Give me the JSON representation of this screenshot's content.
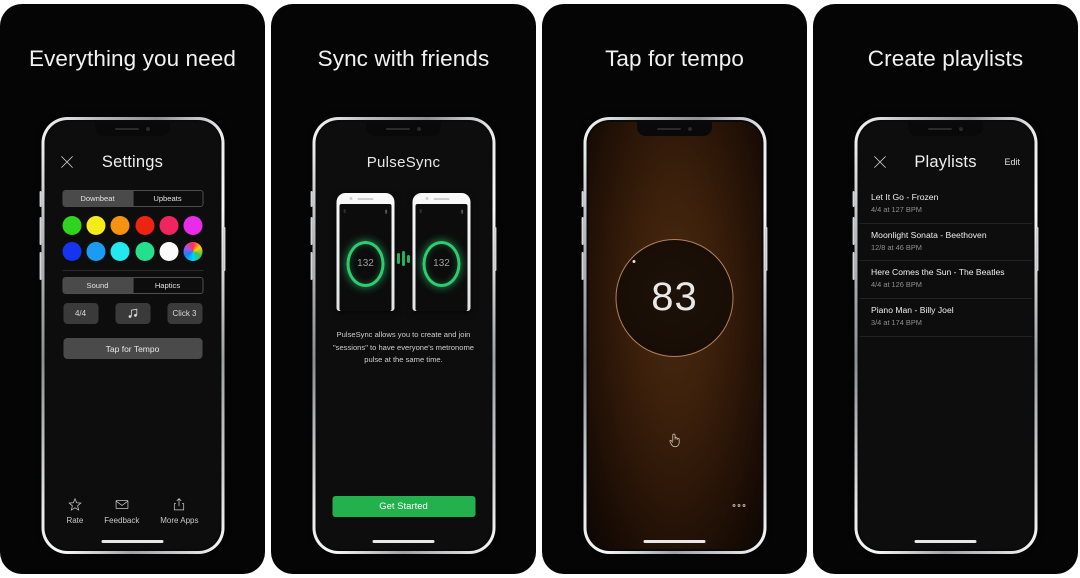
{
  "panels": [
    {
      "title": "Everything you need",
      "screen": {
        "close_icon": "close-icon",
        "title": "Settings",
        "beat_segment": {
          "options": [
            "Downbeat",
            "Upbeats"
          ],
          "selected": "Downbeat"
        },
        "colors": [
          "#2fd41f",
          "#f4eb1a",
          "#f59211",
          "#ee2413",
          "#f0245e",
          "#e92ce9",
          "#1633f0",
          "#1b9cf4",
          "#23e8f0",
          "#24e08d",
          "#fbfbfb",
          "rainbow"
        ],
        "output_segment": {
          "options": [
            "Sound",
            "Haptics"
          ],
          "selected": "Sound"
        },
        "controls": {
          "time_signature": "4/4",
          "sound_icon": "music-note-icon",
          "click": "Click 3"
        },
        "tap_button": "Tap for Tempo",
        "tabs": [
          {
            "label": "Rate",
            "icon": "star-icon"
          },
          {
            "label": "Feedback",
            "icon": "envelope-icon"
          },
          {
            "label": "More Apps",
            "icon": "share-icon"
          }
        ]
      }
    },
    {
      "title": "Sync with friends",
      "screen": {
        "app_name": "PulseSync",
        "device_bpm_left": "132",
        "device_bpm_right": "132",
        "sync_icon": "wireless-waves-icon",
        "body": "PulseSync allows you to create and join \"sessions\" to have everyone's metronome pulse at the same time.",
        "cta": "Get Started",
        "cta_color": "#22b14c"
      }
    },
    {
      "title": "Tap for tempo",
      "screen": {
        "bpm": "83",
        "tap_icon": "tap-hand-icon",
        "menu_icon": "more-dots-icon"
      }
    },
    {
      "title": "Create playlists",
      "screen": {
        "close_icon": "close-icon",
        "title": "Playlists",
        "edit": "Edit",
        "items": [
          {
            "name": "Let It Go - Frozen",
            "meta": "4/4 at 127 BPM"
          },
          {
            "name": "Moonlight Sonata - Beethoven",
            "meta": "12/8 at 46 BPM"
          },
          {
            "name": "Here Comes the Sun - The Beatles",
            "meta": "4/4 at 126 BPM"
          },
          {
            "name": "Piano Man - Billy Joel",
            "meta": "3/4 at 174 BPM"
          }
        ]
      }
    }
  ]
}
